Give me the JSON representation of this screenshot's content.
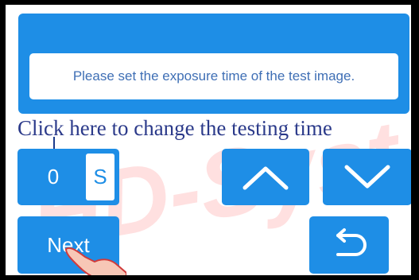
{
  "message": "Please set the exposure time of the test image.",
  "annotation": "Click here to change the testing time",
  "time": {
    "value": "0",
    "unit": "S"
  },
  "buttons": {
    "increase_icon": "chevron-up-icon",
    "decrease_icon": "chevron-down-icon",
    "next_label": "Next",
    "back_icon": "return-icon"
  },
  "watermark_icon": "brand-watermark-logo",
  "colors": {
    "accent": "#1e8ee6",
    "message_text": "#3f6fb5",
    "annotation_text": "#2b3a8a",
    "frame": "#000000"
  }
}
